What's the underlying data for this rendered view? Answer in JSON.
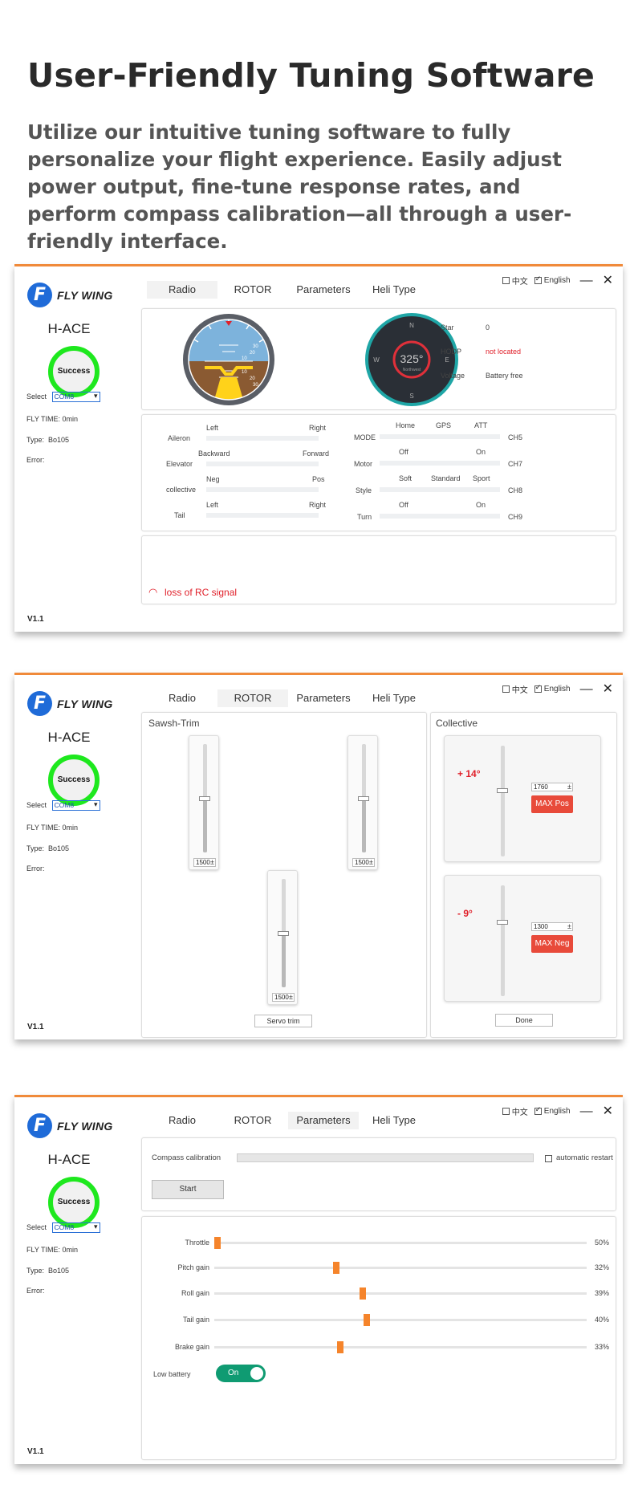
{
  "hero": {
    "title": "User-Friendly Tuning Software",
    "description": "Utilize our intuitive tuning software to fully personalize your flight experience. Easily adjust power output, fine-tune response rates, and perform compass calibration—all through a user-friendly interface."
  },
  "app": {
    "logo_text": "FLY WING",
    "logo_mark": "F",
    "model": "H-ACE",
    "status": "Success",
    "select_label": "Select",
    "port": "COM8",
    "fly_time_label": "FLY TIME:",
    "fly_time_value": "0min",
    "type_label": "Type:",
    "type_value": "Bo105",
    "error_label": "Error:",
    "version": "V1.1",
    "tabs": [
      "Radio",
      "ROTOR",
      "Parameters",
      "Heli Type"
    ],
    "lang_cn": "中文",
    "lang_en": "English",
    "minimize": "—",
    "close": "✕"
  },
  "colors": {
    "accent": "#f08a3a",
    "success_ring": "#1ee81e",
    "alert": "#e0202a",
    "toggle": "#0f9b72",
    "slider_thumb": "#f5842b"
  },
  "radio": {
    "compass_heading": "325°",
    "compass_sub": "Northwest",
    "compass_n": "N",
    "compass_s": "S",
    "compass_e": "E",
    "compass_w": "W",
    "horizon_ticks": [
      "30",
      "20",
      "10",
      "10",
      "20",
      "30"
    ],
    "info": [
      {
        "label": "Star",
        "value": "0"
      },
      {
        "label": "HODP",
        "value": "not located"
      },
      {
        "label": "Voltage",
        "value": "Battery free"
      }
    ],
    "left_channels": [
      {
        "name": "Aileron",
        "left": "Left",
        "right": "Right"
      },
      {
        "name": "Elevator",
        "left": "Backward",
        "right": "Forward"
      },
      {
        "name": "collective",
        "left": "Neg",
        "right": "Pos"
      },
      {
        "name": "Tail",
        "left": "Left",
        "right": "Right"
      }
    ],
    "right_channels": [
      {
        "name": "MODE",
        "ch": "CH5",
        "opts": [
          "Home",
          "GPS",
          "ATT"
        ]
      },
      {
        "name": "Motor",
        "ch": "CH7",
        "opts": [
          "Off",
          "On"
        ]
      },
      {
        "name": "Style",
        "ch": "CH8",
        "opts": [
          "Soft",
          "Standard",
          "Sport"
        ]
      },
      {
        "name": "Turn",
        "ch": "CH9",
        "opts": [
          "Off",
          "On"
        ]
      }
    ],
    "alert": "loss of RC signal"
  },
  "rotor": {
    "swash_title": "Sawsh-Trim",
    "swash_values": [
      "1500",
      "1500",
      "1500"
    ],
    "swash_levels": [
      0.5,
      0.5,
      0.5
    ],
    "servo_trim": "Servo trim",
    "collective_title": "Collective",
    "pos_angle": "+ 14°",
    "pos_value": "1760",
    "pos_btn": "MAX Pos",
    "neg_angle": "- 9°",
    "neg_value": "1300",
    "neg_btn": "MAX Neg",
    "done": "Done"
  },
  "parameters": {
    "compass_label": "Compass calibration",
    "auto_restart": "automatic restart",
    "start": "Start",
    "gains": [
      {
        "label": "Throttle",
        "value": "50%",
        "level": 0
      },
      {
        "label": "Pitch gain",
        "value": "32%",
        "level": 0.32
      },
      {
        "label": "Roll gain",
        "value": "39%",
        "level": 0.39
      },
      {
        "label": "Tail gain",
        "value": "40%",
        "level": 0.4
      },
      {
        "label": "Brake gain",
        "value": "33%",
        "level": 0.33
      }
    ],
    "low_battery": "Low battery",
    "toggle": "On"
  }
}
